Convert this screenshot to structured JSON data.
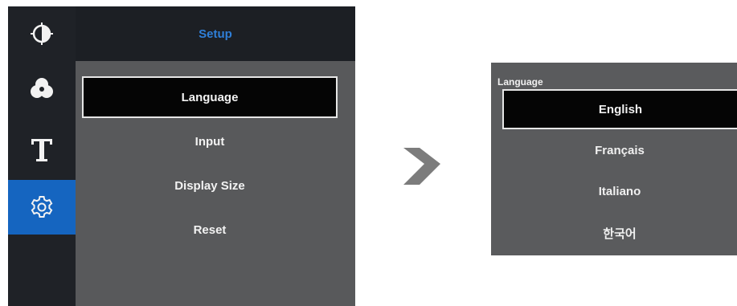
{
  "colors": {
    "panel_bg": "#58595b",
    "sidebar_bg": "#1f2227",
    "active_accent": "#1565c0",
    "header_title": "#2f7fd8",
    "selected_bg": "#050505",
    "arrow": "#7c7c7c"
  },
  "setup_menu": {
    "title": "Setup",
    "sidebar_icons": [
      "brightness-contrast-icon",
      "color-icon",
      "text-icon",
      "settings-gear-icon"
    ],
    "active_sidebar_index": 3,
    "items": [
      {
        "label": "Language",
        "selected": true
      },
      {
        "label": "Input",
        "selected": false
      },
      {
        "label": "Display Size",
        "selected": false
      },
      {
        "label": "Reset",
        "selected": false
      }
    ]
  },
  "transition_icon": "right-arrow-icon",
  "language_menu": {
    "title": "Language",
    "items": [
      {
        "label": "English",
        "selected": true
      },
      {
        "label": "Français",
        "selected": false
      },
      {
        "label": "Italiano",
        "selected": false
      },
      {
        "label": "한국어",
        "selected": false
      }
    ]
  }
}
